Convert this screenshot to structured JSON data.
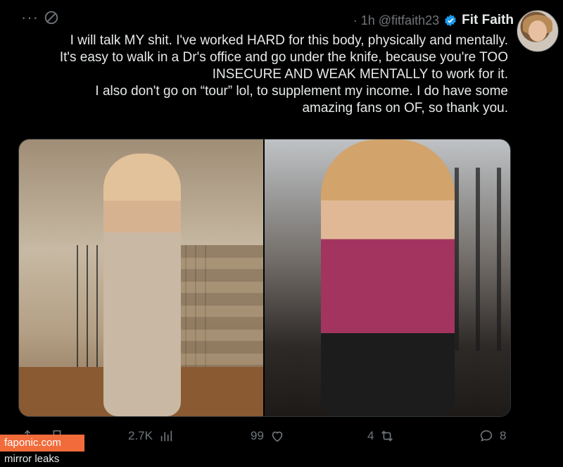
{
  "header": {
    "name": "Fit Faith",
    "handle": "@fitfaith23",
    "time": "· 1h",
    "menu": "···"
  },
  "tweet": {
    "lines": [
      "I will talk MY shit. I've worked HARD for this body, physically and mentally.",
      "It's easy to walk in a Dr's office and go under the knife, because you're TOO",
      "INSECURE AND WEAK MENTALLY to work for it.",
      "I also don't go on “tour” lol, to supplement my income. I do have some",
      "amazing fans on OF, so thank you."
    ]
  },
  "actions": {
    "replies": "8",
    "reposts": "4",
    "likes": "99",
    "views": "2.7K"
  },
  "watermark": {
    "site": "faponic.com",
    "subtitle": "mirror leaks"
  },
  "colors": {
    "background": "#000000",
    "text": "#e7e9ea",
    "muted": "#71767b",
    "verified": "#1d9bf0",
    "watermark_accent": "#f26b3a"
  },
  "icons": [
    "more-icon",
    "grok-icon",
    "verified-icon",
    "reply-icon",
    "repost-icon",
    "like-icon",
    "views-icon",
    "bookmark-icon",
    "share-icon"
  ]
}
